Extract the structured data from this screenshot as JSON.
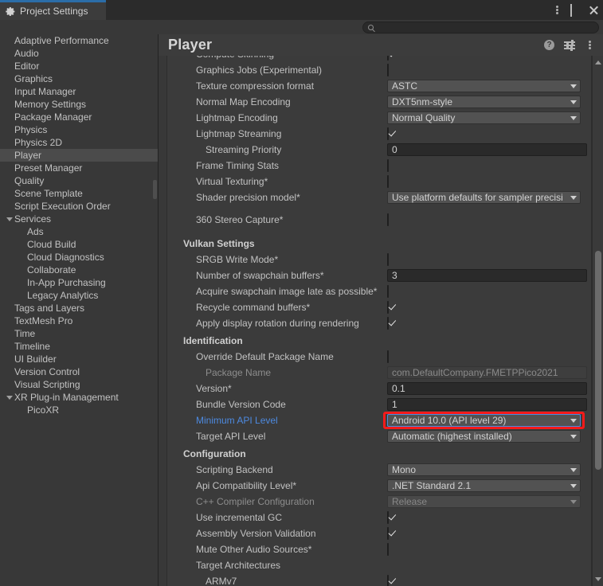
{
  "window": {
    "tab_title": "Project Settings",
    "tab_icon": "gear-icon",
    "controls": {
      "menu": "kebab-icon",
      "maximize": "maximize-icon",
      "close": "close-icon"
    },
    "accent_color": "#2b6da8"
  },
  "search": {
    "placeholder": "",
    "value": "",
    "icon": "search-icon"
  },
  "sidebar": {
    "items": [
      {
        "label": "Adaptive Performance",
        "indent": 0,
        "selected": false,
        "expander": false
      },
      {
        "label": "Audio",
        "indent": 0,
        "selected": false,
        "expander": false
      },
      {
        "label": "Editor",
        "indent": 0,
        "selected": false,
        "expander": false
      },
      {
        "label": "Graphics",
        "indent": 0,
        "selected": false,
        "expander": false
      },
      {
        "label": "Input Manager",
        "indent": 0,
        "selected": false,
        "expander": false
      },
      {
        "label": "Memory Settings",
        "indent": 0,
        "selected": false,
        "expander": false
      },
      {
        "label": "Package Manager",
        "indent": 0,
        "selected": false,
        "expander": false
      },
      {
        "label": "Physics",
        "indent": 0,
        "selected": false,
        "expander": false
      },
      {
        "label": "Physics 2D",
        "indent": 0,
        "selected": false,
        "expander": false
      },
      {
        "label": "Player",
        "indent": 0,
        "selected": true,
        "expander": false
      },
      {
        "label": "Preset Manager",
        "indent": 0,
        "selected": false,
        "expander": false
      },
      {
        "label": "Quality",
        "indent": 0,
        "selected": false,
        "expander": false
      },
      {
        "label": "Scene Template",
        "indent": 0,
        "selected": false,
        "expander": false
      },
      {
        "label": "Script Execution Order",
        "indent": 0,
        "selected": false,
        "expander": false
      },
      {
        "label": "Services",
        "indent": 0,
        "selected": false,
        "expander": true
      },
      {
        "label": "Ads",
        "indent": 1,
        "selected": false,
        "expander": false
      },
      {
        "label": "Cloud Build",
        "indent": 1,
        "selected": false,
        "expander": false
      },
      {
        "label": "Cloud Diagnostics",
        "indent": 1,
        "selected": false,
        "expander": false
      },
      {
        "label": "Collaborate",
        "indent": 1,
        "selected": false,
        "expander": false
      },
      {
        "label": "In-App Purchasing",
        "indent": 1,
        "selected": false,
        "expander": false
      },
      {
        "label": "Legacy Analytics",
        "indent": 1,
        "selected": false,
        "expander": false
      },
      {
        "label": "Tags and Layers",
        "indent": 0,
        "selected": false,
        "expander": false
      },
      {
        "label": "TextMesh Pro",
        "indent": 0,
        "selected": false,
        "expander": false
      },
      {
        "label": "Time",
        "indent": 0,
        "selected": false,
        "expander": false
      },
      {
        "label": "Timeline",
        "indent": 0,
        "selected": false,
        "expander": false
      },
      {
        "label": "UI Builder",
        "indent": 0,
        "selected": false,
        "expander": false
      },
      {
        "label": "Version Control",
        "indent": 0,
        "selected": false,
        "expander": false
      },
      {
        "label": "Visual Scripting",
        "indent": 0,
        "selected": false,
        "expander": false
      },
      {
        "label": "XR Plug-in Management",
        "indent": 0,
        "selected": false,
        "expander": true
      },
      {
        "label": "PicoXR",
        "indent": 1,
        "selected": false,
        "expander": false
      }
    ]
  },
  "panel": {
    "title": "Player",
    "icons": {
      "help": "?",
      "preset": "preset-icon",
      "menu": "kebab-icon"
    }
  },
  "rows": [
    {
      "kind": "check",
      "label": "Compute Skinning",
      "indent": 0,
      "value": true,
      "clipped": true
    },
    {
      "kind": "check",
      "label": "Graphics Jobs (Experimental)",
      "indent": 0,
      "value": false
    },
    {
      "kind": "select",
      "label": "Texture compression format",
      "indent": 0,
      "value": "ASTC"
    },
    {
      "kind": "select",
      "label": "Normal Map Encoding",
      "indent": 0,
      "value": "DXT5nm-style"
    },
    {
      "kind": "select",
      "label": "Lightmap Encoding",
      "indent": 0,
      "value": "Normal Quality"
    },
    {
      "kind": "check",
      "label": "Lightmap Streaming",
      "indent": 0,
      "value": true
    },
    {
      "kind": "text",
      "label": "Streaming Priority",
      "indent": 1,
      "value": "0",
      "wide": true
    },
    {
      "kind": "check",
      "label": "Frame Timing Stats",
      "indent": 0,
      "value": false
    },
    {
      "kind": "check",
      "label": "Virtual Texturing*",
      "indent": 0,
      "value": false
    },
    {
      "kind": "select",
      "label": "Shader precision model*",
      "indent": 0,
      "value": "Use platform defaults for sampler precisi"
    },
    {
      "kind": "spacer"
    },
    {
      "kind": "check",
      "label": "360 Stereo Capture*",
      "indent": 0,
      "value": false
    },
    {
      "kind": "spacer"
    },
    {
      "kind": "section",
      "label": "Vulkan Settings"
    },
    {
      "kind": "check",
      "label": "SRGB Write Mode*",
      "indent": 0,
      "value": false
    },
    {
      "kind": "text",
      "label": "Number of swapchain buffers*",
      "indent": 0,
      "value": "3",
      "wide": true
    },
    {
      "kind": "check",
      "label": "Acquire swapchain image late as possible*",
      "indent": 0,
      "value": false
    },
    {
      "kind": "check",
      "label": "Recycle command buffers*",
      "indent": 0,
      "value": true
    },
    {
      "kind": "check",
      "label": "Apply display rotation during rendering",
      "indent": 0,
      "value": true
    },
    {
      "kind": "section",
      "label": "Identification"
    },
    {
      "kind": "check",
      "label": "Override Default Package Name",
      "indent": 0,
      "value": false
    },
    {
      "kind": "text",
      "label": "Package Name",
      "indent": 1,
      "value": "com.DefaultCompany.FMETPPico2021",
      "disabled": true,
      "wide": true
    },
    {
      "kind": "text",
      "label": "Version*",
      "indent": 0,
      "value": "0.1",
      "wide": true
    },
    {
      "kind": "text",
      "label": "Bundle Version Code",
      "indent": 0,
      "value": "1",
      "wide": true
    },
    {
      "kind": "select",
      "label": "Minimum API Level",
      "indent": 0,
      "value": "Android 10.0 (API level 29)",
      "label_highlight": true,
      "focused": true,
      "annotated": true
    },
    {
      "kind": "select",
      "label": "Target API Level",
      "indent": 0,
      "value": "Automatic (highest installed)"
    },
    {
      "kind": "section",
      "label": "Configuration"
    },
    {
      "kind": "select",
      "label": "Scripting Backend",
      "indent": 0,
      "value": "Mono"
    },
    {
      "kind": "select",
      "label": "Api Compatibility Level*",
      "indent": 0,
      "value": ".NET Standard 2.1"
    },
    {
      "kind": "select",
      "label": "C++ Compiler Configuration",
      "indent": 0,
      "value": "Release",
      "disabled": true
    },
    {
      "kind": "check",
      "label": "Use incremental GC",
      "indent": 0,
      "value": true
    },
    {
      "kind": "check",
      "label": "Assembly Version Validation",
      "indent": 0,
      "value": true
    },
    {
      "kind": "check",
      "label": "Mute Other Audio Sources*",
      "indent": 0,
      "value": false
    },
    {
      "kind": "label",
      "label": "Target Architectures",
      "indent": 0
    },
    {
      "kind": "check",
      "label": "ARMv7",
      "indent": 1,
      "value": true
    }
  ],
  "annotation": {
    "color": "#f51a1a",
    "target": "Minimum API Level"
  }
}
